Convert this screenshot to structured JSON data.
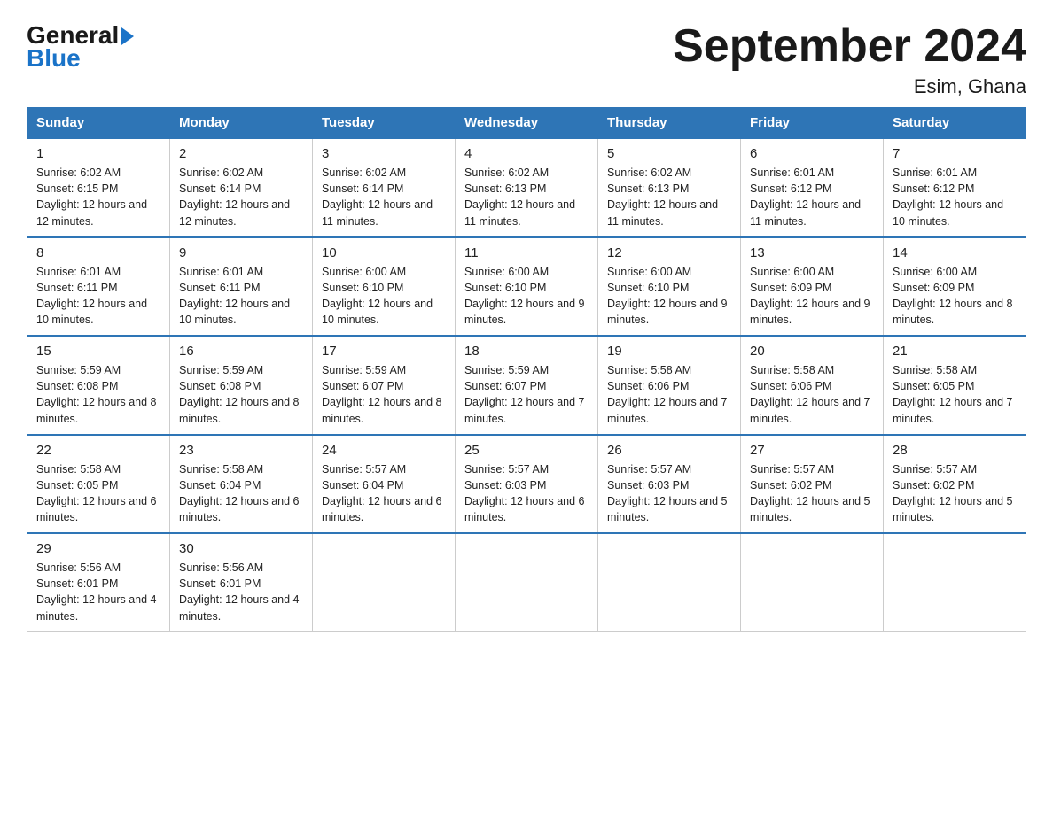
{
  "logo": {
    "general": "General",
    "arrow_symbol": "▶",
    "blue": "Blue"
  },
  "header": {
    "title": "September 2024",
    "subtitle": "Esim, Ghana"
  },
  "weekdays": [
    "Sunday",
    "Monday",
    "Tuesday",
    "Wednesday",
    "Thursday",
    "Friday",
    "Saturday"
  ],
  "weeks": [
    [
      {
        "day": "1",
        "sunrise": "Sunrise: 6:02 AM",
        "sunset": "Sunset: 6:15 PM",
        "daylight": "Daylight: 12 hours and 12 minutes."
      },
      {
        "day": "2",
        "sunrise": "Sunrise: 6:02 AM",
        "sunset": "Sunset: 6:14 PM",
        "daylight": "Daylight: 12 hours and 12 minutes."
      },
      {
        "day": "3",
        "sunrise": "Sunrise: 6:02 AM",
        "sunset": "Sunset: 6:14 PM",
        "daylight": "Daylight: 12 hours and 11 minutes."
      },
      {
        "day": "4",
        "sunrise": "Sunrise: 6:02 AM",
        "sunset": "Sunset: 6:13 PM",
        "daylight": "Daylight: 12 hours and 11 minutes."
      },
      {
        "day": "5",
        "sunrise": "Sunrise: 6:02 AM",
        "sunset": "Sunset: 6:13 PM",
        "daylight": "Daylight: 12 hours and 11 minutes."
      },
      {
        "day": "6",
        "sunrise": "Sunrise: 6:01 AM",
        "sunset": "Sunset: 6:12 PM",
        "daylight": "Daylight: 12 hours and 11 minutes."
      },
      {
        "day": "7",
        "sunrise": "Sunrise: 6:01 AM",
        "sunset": "Sunset: 6:12 PM",
        "daylight": "Daylight: 12 hours and 10 minutes."
      }
    ],
    [
      {
        "day": "8",
        "sunrise": "Sunrise: 6:01 AM",
        "sunset": "Sunset: 6:11 PM",
        "daylight": "Daylight: 12 hours and 10 minutes."
      },
      {
        "day": "9",
        "sunrise": "Sunrise: 6:01 AM",
        "sunset": "Sunset: 6:11 PM",
        "daylight": "Daylight: 12 hours and 10 minutes."
      },
      {
        "day": "10",
        "sunrise": "Sunrise: 6:00 AM",
        "sunset": "Sunset: 6:10 PM",
        "daylight": "Daylight: 12 hours and 10 minutes."
      },
      {
        "day": "11",
        "sunrise": "Sunrise: 6:00 AM",
        "sunset": "Sunset: 6:10 PM",
        "daylight": "Daylight: 12 hours and 9 minutes."
      },
      {
        "day": "12",
        "sunrise": "Sunrise: 6:00 AM",
        "sunset": "Sunset: 6:10 PM",
        "daylight": "Daylight: 12 hours and 9 minutes."
      },
      {
        "day": "13",
        "sunrise": "Sunrise: 6:00 AM",
        "sunset": "Sunset: 6:09 PM",
        "daylight": "Daylight: 12 hours and 9 minutes."
      },
      {
        "day": "14",
        "sunrise": "Sunrise: 6:00 AM",
        "sunset": "Sunset: 6:09 PM",
        "daylight": "Daylight: 12 hours and 8 minutes."
      }
    ],
    [
      {
        "day": "15",
        "sunrise": "Sunrise: 5:59 AM",
        "sunset": "Sunset: 6:08 PM",
        "daylight": "Daylight: 12 hours and 8 minutes."
      },
      {
        "day": "16",
        "sunrise": "Sunrise: 5:59 AM",
        "sunset": "Sunset: 6:08 PM",
        "daylight": "Daylight: 12 hours and 8 minutes."
      },
      {
        "day": "17",
        "sunrise": "Sunrise: 5:59 AM",
        "sunset": "Sunset: 6:07 PM",
        "daylight": "Daylight: 12 hours and 8 minutes."
      },
      {
        "day": "18",
        "sunrise": "Sunrise: 5:59 AM",
        "sunset": "Sunset: 6:07 PM",
        "daylight": "Daylight: 12 hours and 7 minutes."
      },
      {
        "day": "19",
        "sunrise": "Sunrise: 5:58 AM",
        "sunset": "Sunset: 6:06 PM",
        "daylight": "Daylight: 12 hours and 7 minutes."
      },
      {
        "day": "20",
        "sunrise": "Sunrise: 5:58 AM",
        "sunset": "Sunset: 6:06 PM",
        "daylight": "Daylight: 12 hours and 7 minutes."
      },
      {
        "day": "21",
        "sunrise": "Sunrise: 5:58 AM",
        "sunset": "Sunset: 6:05 PM",
        "daylight": "Daylight: 12 hours and 7 minutes."
      }
    ],
    [
      {
        "day": "22",
        "sunrise": "Sunrise: 5:58 AM",
        "sunset": "Sunset: 6:05 PM",
        "daylight": "Daylight: 12 hours and 6 minutes."
      },
      {
        "day": "23",
        "sunrise": "Sunrise: 5:58 AM",
        "sunset": "Sunset: 6:04 PM",
        "daylight": "Daylight: 12 hours and 6 minutes."
      },
      {
        "day": "24",
        "sunrise": "Sunrise: 5:57 AM",
        "sunset": "Sunset: 6:04 PM",
        "daylight": "Daylight: 12 hours and 6 minutes."
      },
      {
        "day": "25",
        "sunrise": "Sunrise: 5:57 AM",
        "sunset": "Sunset: 6:03 PM",
        "daylight": "Daylight: 12 hours and 6 minutes."
      },
      {
        "day": "26",
        "sunrise": "Sunrise: 5:57 AM",
        "sunset": "Sunset: 6:03 PM",
        "daylight": "Daylight: 12 hours and 5 minutes."
      },
      {
        "day": "27",
        "sunrise": "Sunrise: 5:57 AM",
        "sunset": "Sunset: 6:02 PM",
        "daylight": "Daylight: 12 hours and 5 minutes."
      },
      {
        "day": "28",
        "sunrise": "Sunrise: 5:57 AM",
        "sunset": "Sunset: 6:02 PM",
        "daylight": "Daylight: 12 hours and 5 minutes."
      }
    ],
    [
      {
        "day": "29",
        "sunrise": "Sunrise: 5:56 AM",
        "sunset": "Sunset: 6:01 PM",
        "daylight": "Daylight: 12 hours and 4 minutes."
      },
      {
        "day": "30",
        "sunrise": "Sunrise: 5:56 AM",
        "sunset": "Sunset: 6:01 PM",
        "daylight": "Daylight: 12 hours and 4 minutes."
      },
      null,
      null,
      null,
      null,
      null
    ]
  ]
}
